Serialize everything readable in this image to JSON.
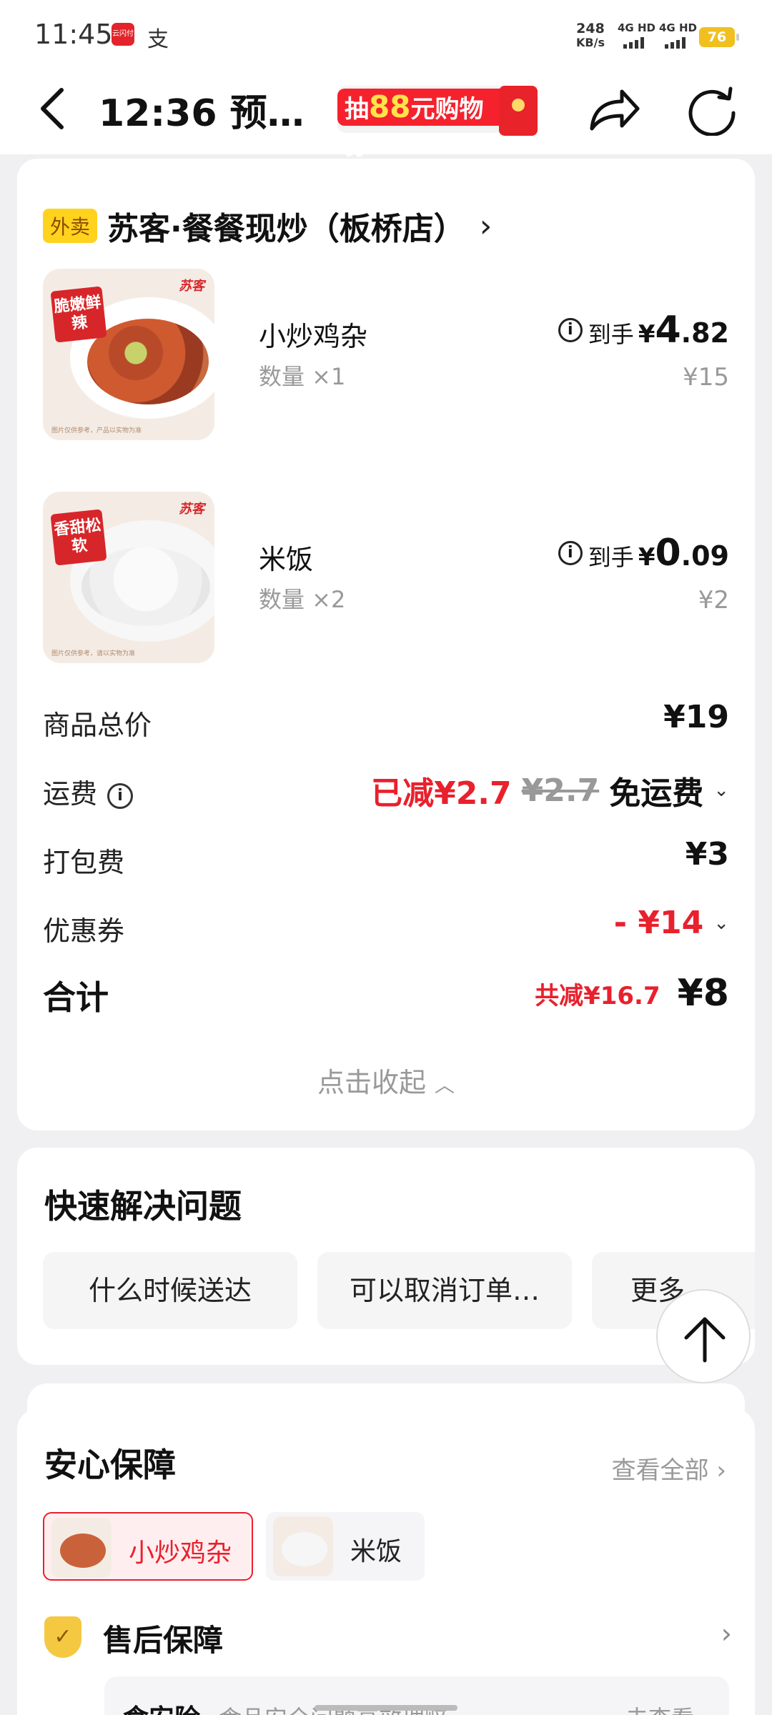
{
  "status_bar": {
    "time": "11:45",
    "app_icon_1": "云闪付",
    "app_icon_2": "支",
    "network_speed": "248",
    "network_unit": "KB/s",
    "sim1": "4G HD",
    "sim2": "4G HD",
    "battery": "76"
  },
  "nav": {
    "title": "12:36 预…",
    "coupon_prefix": "抽",
    "coupon_amount": "88",
    "coupon_suffix": "元购物券"
  },
  "order": {
    "shop_tag": "外卖",
    "shop_name": "苏客·餐餐现炒（板桥店）",
    "items": [
      {
        "name": "小炒鸡杂",
        "qty": "数量 ×1",
        "price_label": "到手",
        "price_currency": "¥",
        "price_int": "4",
        "price_dec": ".82",
        "original_price": "¥15",
        "badge": "脆嫩鲜辣",
        "logo": "苏客",
        "fine_print": "图片仅供参考，产品以实物为准"
      },
      {
        "name": "米饭",
        "qty": "数量 ×2",
        "price_label": "到手",
        "price_currency": "¥",
        "price_int": "0",
        "price_dec": ".09",
        "original_price": "¥2",
        "badge": "香甜松软",
        "logo": "苏客",
        "fine_print": "图片仅供参考，请以实物为准"
      }
    ],
    "summary": {
      "goods_total_label": "商品总价",
      "goods_total": "¥19",
      "delivery_label": "运费",
      "delivery_saved": "已减¥2.7",
      "delivery_original": "¥2.7",
      "delivery_value": "免运费",
      "packing_label": "打包费",
      "packing_value": "¥3",
      "coupon_label": "优惠券",
      "coupon_value": "- ¥14",
      "total_label": "合计",
      "total_saved": "共减¥16.7",
      "total_value": "¥8"
    },
    "collapse_label": "点击收起"
  },
  "quick_solve": {
    "title": "快速解决问题",
    "buttons": [
      "什么时候送达",
      "可以取消订单…",
      "更多"
    ]
  },
  "guarantee": {
    "title": "安心保障",
    "see_all": "查看全部",
    "chips": [
      "小炒鸡杂",
      "米饭"
    ],
    "after_sale_title": "售后保障",
    "insurance_name": "食安险",
    "insurance_desc": "食品安全问题高效理赔",
    "insurance_link": "去查看"
  },
  "colors": {
    "accent_red": "#e8212d",
    "tag_yellow": "#ffd21e",
    "background": "#f0f0f2"
  }
}
